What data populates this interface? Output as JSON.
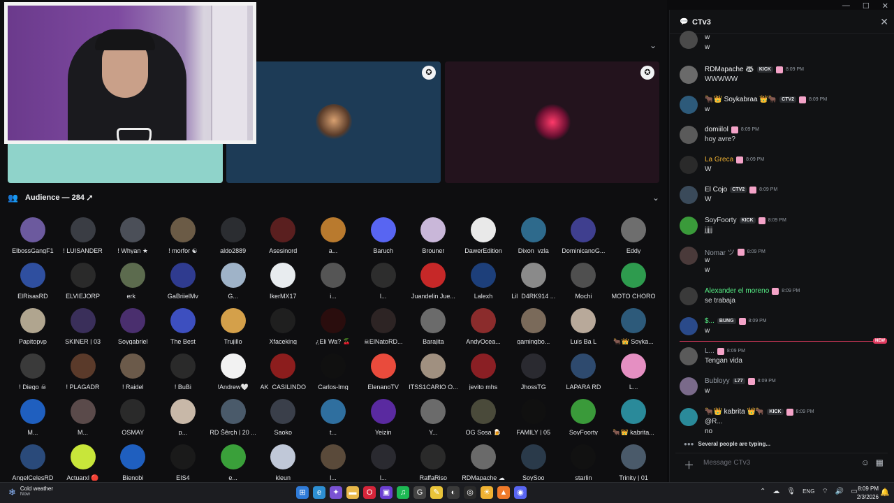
{
  "window": {
    "minimize": "—",
    "maximize": "☐",
    "close": "✕"
  },
  "audience": {
    "title": "Audience — 284"
  },
  "members": [
    {
      "name": "ElbossGangF1",
      "c": "#6c5a9e"
    },
    {
      "name": "! LUISANDER",
      "c": "#3a3d44"
    },
    {
      "name": "! Whyan ★",
      "c": "#4b4f58"
    },
    {
      "name": "! morfor ☯",
      "c": "#6b5b46"
    },
    {
      "name": "aldo2889",
      "c": "#2b2d31"
    },
    {
      "name": "Asesinord",
      "c": "#5a1f1f"
    },
    {
      "name": "a...",
      "c": "#b97a2e"
    },
    {
      "name": "Baruch",
      "c": "#5865f2"
    },
    {
      "name": "Brouner",
      "c": "#c9b7d9"
    },
    {
      "name": "DawerEdition",
      "c": "#e9e9e9"
    },
    {
      "name": "Dixon_vzla",
      "c": "#2e6a8c"
    },
    {
      "name": "DominicanoG...",
      "c": "#3f3f8f"
    },
    {
      "name": "Eddy",
      "c": "#6e6e6e"
    },
    {
      "name": "ElRisasRD",
      "c": "#2f4f9f"
    },
    {
      "name": "ELVIEJORP",
      "c": "#2a2a2a"
    },
    {
      "name": "erk_",
      "c": "#5c6b4e"
    },
    {
      "name": "GaBriielMv",
      "c": "#2f3b8f"
    },
    {
      "name": "G...",
      "c": "#9fb3c8"
    },
    {
      "name": "IkerMX17",
      "c": "#e8ecef"
    },
    {
      "name": "i...",
      "c": "#555555"
    },
    {
      "name": "l...",
      "c": "#2d2d2d"
    },
    {
      "name": "Juandelin Jue...",
      "c": "#c62828"
    },
    {
      "name": "Lalexh",
      "c": "#1d3f7a"
    },
    {
      "name": "Lil_D4RK914 ...",
      "c": "#8a8a8a"
    },
    {
      "name": "Mochi",
      "c": "#4f4f4f"
    },
    {
      "name": "MOTO CHORO",
      "c": "#2e9b4e"
    },
    {
      "name": "Papitopvp",
      "c": "#b0a58f"
    },
    {
      "name": "SKINER | 03",
      "c": "#3a2f5a"
    },
    {
      "name": "Soygabriel",
      "c": "#4a2f6e"
    },
    {
      "name": "The Best",
      "c": "#3d4fbf"
    },
    {
      "name": "Trujillo",
      "c": "#d4a04a"
    },
    {
      "name": "Xfaceking",
      "c": "#1f1f1f"
    },
    {
      "name": "¿Eli Wa? 🍒",
      "c": "#2a0d0d"
    },
    {
      "name": "☠ElNatoRD...",
      "c": "#2d2424"
    },
    {
      "name": "Barajita",
      "c": "#6b6b6b"
    },
    {
      "name": "AndyOcea...",
      "c": "#8b2c2c"
    },
    {
      "name": "gamingbo...",
      "c": "#7a6a5a"
    },
    {
      "name": "Luis Ba L",
      "c": "#b8a99a"
    },
    {
      "name": "🐂👑 Soyka...",
      "c": "#2d5a7a"
    },
    {
      "name": "! Diego ☠",
      "c": "#3a3a3a"
    },
    {
      "name": "! PLAGADR",
      "c": "#5a3a2a"
    },
    {
      "name": "! Raidel",
      "c": "#6b5a4a"
    },
    {
      "name": "! BuBi",
      "c": "#2a2a2a"
    },
    {
      "name": "!Andrew🤍",
      "c": "#f2f2f2"
    },
    {
      "name": "AK_CASILINDO",
      "c": "#8c1d1d"
    },
    {
      "name": "Carlos-lmg",
      "c": "#101010"
    },
    {
      "name": "ElenanoTV",
      "c": "#e94b3c"
    },
    {
      "name": "ITSS1CARIO O...",
      "c": "#a09080"
    },
    {
      "name": "jevito mhs",
      "c": "#8a1f24"
    },
    {
      "name": "JhossTG",
      "c": "#2a2a30"
    },
    {
      "name": "LAPARA RD",
      "c": "#2e4a6e"
    },
    {
      "name": "L...",
      "c": "#e58fc2"
    },
    {
      "name": "M...",
      "c": "#1f5fbf"
    },
    {
      "name": "M...",
      "c": "#5a4a4a"
    },
    {
      "name": "OSMAY",
      "c": "#2a2a2a"
    },
    {
      "name": "p...",
      "c": "#c8b8a8"
    },
    {
      "name": "RD Šêrçh | 20 ...",
      "c": "#4a5a6a"
    },
    {
      "name": "Saoko",
      "c": "#3a3f4a"
    },
    {
      "name": "t...",
      "c": "#2f6f9f"
    },
    {
      "name": "Yeizin",
      "c": "#5a2aa0"
    },
    {
      "name": "Y...",
      "c": "#6b6b6b"
    },
    {
      "name": "OG Sosa 🍺",
      "c": "#4a4a3a"
    },
    {
      "name": "FAMILY | 05",
      "c": "#101010"
    },
    {
      "name": "SoyFoorty",
      "c": "#3a9a3a"
    },
    {
      "name": "🐂👑 kabrita...",
      "c": "#2a8a9a"
    },
    {
      "name": "AngelCelesRD",
      "c": "#2a4a7a"
    },
    {
      "name": "Actuarxl 🔴",
      "c": "#c8e63a"
    },
    {
      "name": "Bienobi",
      "c": "#1f5fbf"
    },
    {
      "name": "EIS4",
      "c": "#1a1a1a"
    },
    {
      "name": "e...",
      "c": "#3aa03a"
    },
    {
      "name": "kleun",
      "c": "#c0c8d8"
    },
    {
      "name": "l...",
      "c": "#5a4a3a"
    },
    {
      "name": "l...",
      "c": "#2a2a30"
    },
    {
      "name": "RaffaRiso",
      "c": "#2a2a2a"
    },
    {
      "name": "RDMapache ☁",
      "c": "#6a6a6a"
    },
    {
      "name": "SoySoo",
      "c": "#2a3a4a"
    },
    {
      "name": "starlin",
      "c": "#111111"
    },
    {
      "name": "Trinity | 01",
      "c": "#4a5a6a"
    }
  ],
  "chat": {
    "channel": "CTv3",
    "placeholder": "Message CTv3",
    "new_label": "NEW",
    "typing": "Several people are typing...",
    "messages": [
      {
        "author": "",
        "author_color": "#f2f3f5",
        "tags": [],
        "time": "",
        "lines": [
          "w",
          "w"
        ],
        "avatar": "#4a4a4a"
      },
      {
        "author": "RDMapache 🦝",
        "author_color": "#f2f3f5",
        "tags": [
          "KICK"
        ],
        "time": "8:09 PM",
        "lines": [
          "WWWWW"
        ],
        "avatar": "#6a6a6a"
      },
      {
        "author": "🐂👑 Soykabraa 👑🐂",
        "author_color": "#f2f3f5",
        "tags": [
          "CTV2"
        ],
        "time": "8:09 PM",
        "lines": [
          "w"
        ],
        "avatar": "#2d5a7a"
      },
      {
        "author": "domiilol",
        "author_color": "#f2f3f5",
        "tags": [],
        "time": "8:09 PM",
        "lines": [
          "hoy avre?"
        ],
        "avatar": "#5a5a5a"
      },
      {
        "author": "La Greca",
        "author_color": "#f0b232",
        "tags": [],
        "time": "8:09 PM",
        "lines": [
          "W"
        ],
        "avatar": "#2a2a2a"
      },
      {
        "author": "El Cojo",
        "author_color": "#f2f3f5",
        "tags": [
          "CTV2"
        ],
        "time": "8:09 PM",
        "lines": [
          "W"
        ],
        "avatar": "#3a4a5a"
      },
      {
        "author": "SoyFoorty",
        "author_color": "#dbdee1",
        "tags": [
          "KICK"
        ],
        "time": "8:09 PM",
        "lines": [
          "jjjjj"
        ],
        "avatar": "#3a9a3a"
      },
      {
        "author": "Nomar ツ",
        "author_color": "#949ba4",
        "tags": [],
        "time": "8:09 PM",
        "lines": [
          "w",
          "w"
        ],
        "avatar": "#4a3a3a"
      },
      {
        "author": "Alexander el moreno",
        "author_color": "#57f287",
        "tags": [],
        "time": "8:09 PM",
        "lines": [
          "se trabaja"
        ],
        "avatar": "#3a3a3a"
      },
      {
        "author": "$...",
        "author_color": "#57f287",
        "tags": [
          "BUNG"
        ],
        "time": "8:09 PM",
        "lines": [
          "w"
        ],
        "avatar": "#2a4a8a"
      },
      {
        "author": "L...",
        "author_color": "#949ba4",
        "tags": [],
        "time": "8:09 PM",
        "lines": [
          "Tengan vida"
        ],
        "avatar": "#5a5a5a"
      },
      {
        "author": "Bubloyy",
        "author_color": "#949ba4",
        "tags": [
          "L77"
        ],
        "time": "8:09 PM",
        "lines": [
          "w"
        ],
        "avatar": "#7a6a8a"
      },
      {
        "author": "🐂👑 kabrita 👑🐂",
        "author_color": "#f2f3f5",
        "tags": [
          "KICK"
        ],
        "time": "8:09 PM",
        "lines": [
          "@R...",
          "no"
        ],
        "avatar": "#2a8a9a"
      }
    ]
  },
  "taskbar": {
    "weather_title": "Cold weather",
    "weather_sub": "Now",
    "lang": "ENG",
    "time": "8:09 PM",
    "date": "2/3/2026"
  }
}
